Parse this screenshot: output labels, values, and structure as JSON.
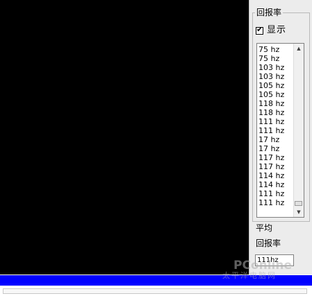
{
  "panel": {
    "group_title": "回报率",
    "show_checkbox": {
      "label": "显示",
      "checked": true,
      "mark": "✔"
    },
    "list": {
      "items": [
        "75 hz",
        "75 hz",
        "103 hz",
        "103 hz",
        "105 hz",
        "105 hz",
        "118 hz",
        "118 hz",
        "111 hz",
        "111 hz",
        "17 hz",
        "17 hz",
        "117 hz",
        "117 hz",
        "114 hz",
        "114 hz",
        "111 hz",
        "111 hz"
      ],
      "scroll_up_glyph": "▲",
      "scroll_down_glyph": "▼"
    },
    "average_label": "平均",
    "rate_label": "回报率",
    "average_value": "111hz"
  },
  "watermark": {
    "main": "PConline",
    "sub": "太平洋电脑网"
  },
  "colors": {
    "canvas": "#000000",
    "status_strip": "#0000ff",
    "panel_bg": "#ececec"
  }
}
